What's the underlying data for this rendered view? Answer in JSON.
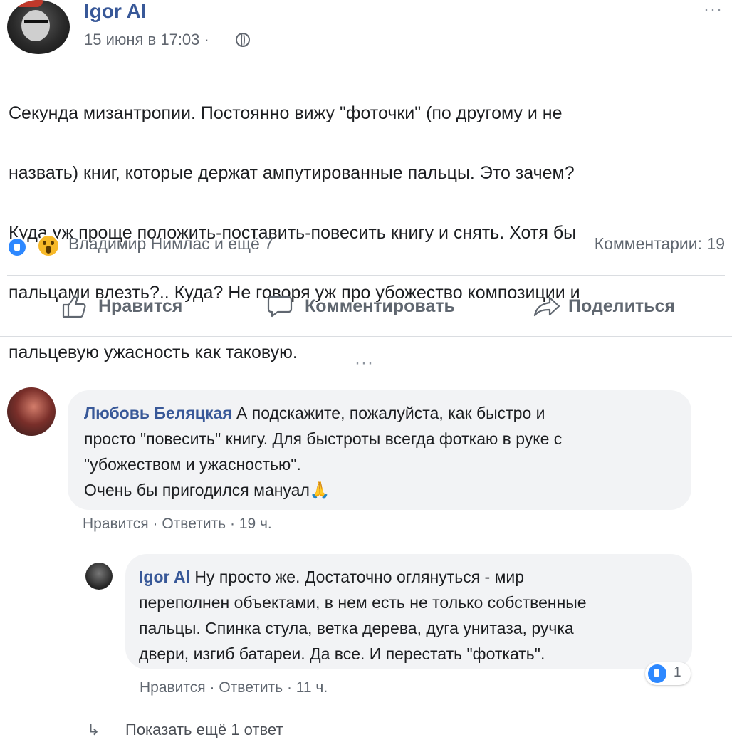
{
  "post": {
    "author": "Igor Al",
    "time": "15 июня в 17:03 ·",
    "more": "···",
    "text_lines": [
      "Секунда мизантропии. Постоянно вижу \"фоточки\" (по другому и не",
      "назвать) книг, которые держат ампутированные пальцы. Это зачем?",
      "Куда уж проще положить-поставить-повесить книгу и снять. Хотя бы",
      "пальцами влезть?.. Куда? Не говоря уж про убожество композиции и",
      "пальцевую ужасность как таковую."
    ],
    "reactions_names": "Владимир Нимлас и ещё 7",
    "comments_count": "Комментарии: 19"
  },
  "actions": {
    "like": "Нравится",
    "comment": "Комментировать",
    "share": "Поделиться"
  },
  "middle_more": "···",
  "comments": [
    {
      "author": "Любовь Беляцкая",
      "lines": [
        " А подскажите, пожалуйста, как быстро и",
        "просто \"повесить\" книгу. Для быстроты всегда фоткаю в руке с",
        "\"убожеством и ужасностью\".",
        "Очень бы пригодился мануал🙏"
      ],
      "like": "Нравится",
      "reply": "Ответить",
      "time": "19 ч."
    }
  ],
  "reply": {
    "author": "Igor Al",
    "lines": [
      " Ну просто же. Достаточно оглянуться - мир",
      "переполнен объектами, в нем есть не только собственные",
      "пальцы. Спинка стула, ветка дерева, дуга унитаза, ручка",
      "двери, изгиб батареи. Да все. И перестать \"фоткать\"."
    ],
    "like": "Нравится",
    "reply": "Ответить",
    "time": "11 ч.",
    "reactions": "1"
  },
  "show_more": "Показать ещё 1 ответ",
  "colors": {
    "link": "#385898",
    "muted": "#606770",
    "bubble": "#f2f3f5",
    "like_blue": "#2d88ff"
  }
}
